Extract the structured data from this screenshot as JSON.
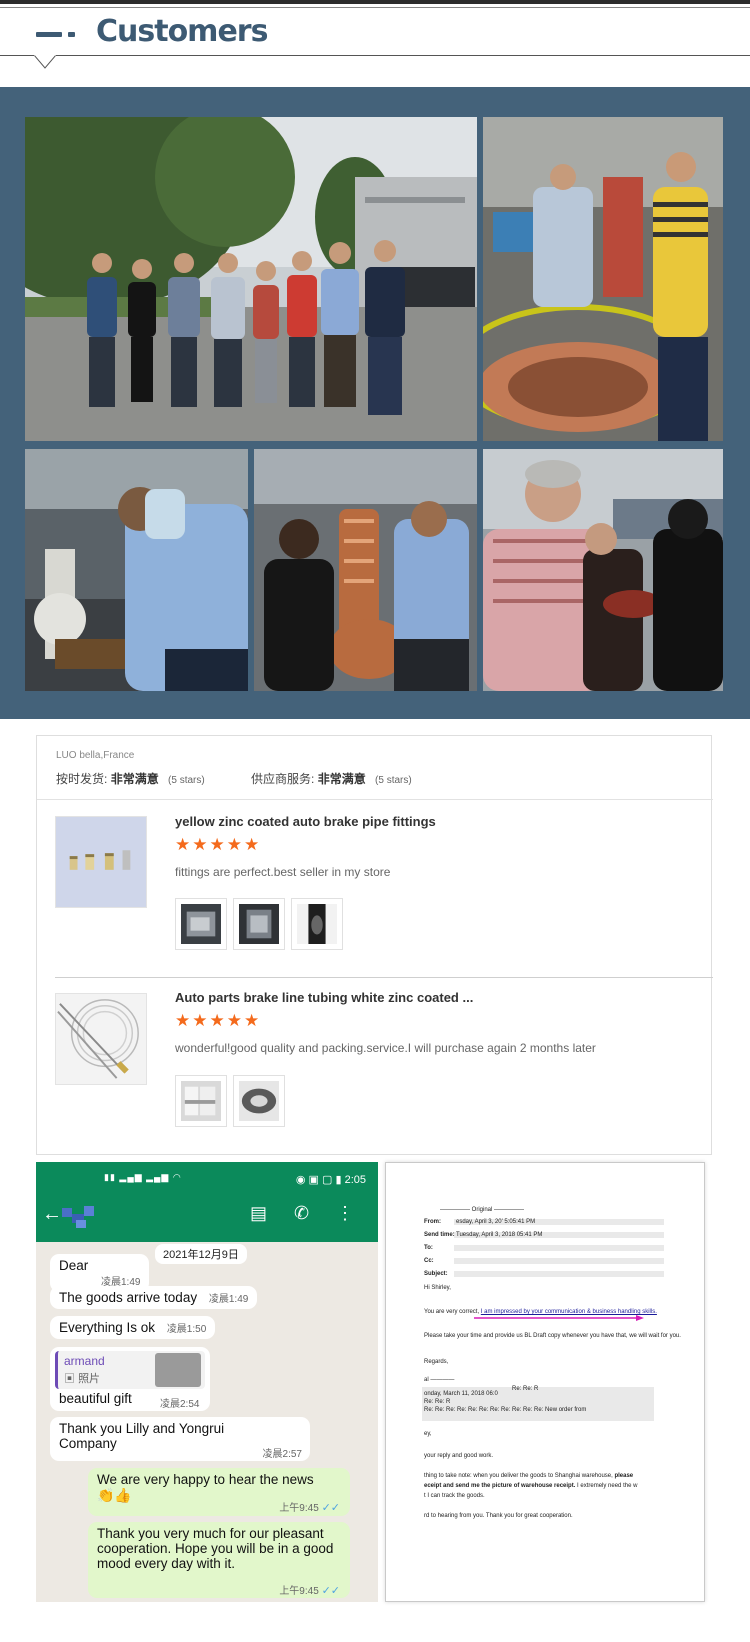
{
  "header": {
    "title": "Customers"
  },
  "review": {
    "user": "LUO bella,France",
    "ratings": [
      {
        "label": "按时发货:",
        "value": "非常满意",
        "stars": "(5 stars)"
      },
      {
        "label": "供应商服务:",
        "value": "非常满意",
        "stars": "(5 stars)"
      }
    ],
    "items": [
      {
        "title": "yellow zinc coated auto brake pipe fittings",
        "stars": "★★★★★",
        "comment": "fittings are perfect.best seller in my store"
      },
      {
        "title": "Auto parts brake line tubing white zinc coated ...",
        "stars": "★★★★★",
        "comment": "wonderful!good quality and packing.service.I will purchase again 2 months later"
      }
    ]
  },
  "chat": {
    "status_right": "2:05",
    "date": "2021年12月9日",
    "messages": [
      {
        "text": "Dear",
        "time": "凌晨1:49"
      },
      {
        "text": "The goods arrive today",
        "time": "凌晨1:49"
      },
      {
        "text": "Everything Is ok",
        "time": "凌晨1:50"
      },
      {
        "quote_name": "armand",
        "quote_type": "照片",
        "text": "beautiful gift",
        "time": "凌晨2:54"
      },
      {
        "text": "Thank you Lilly and Yongrui Company",
        "time": "凌晨2:57"
      },
      {
        "text": "We are very happy to hear the news",
        "emoji": "👏👍",
        "time": "上午9:45",
        "mine": true
      },
      {
        "text": "Thank you very much for our pleasant cooperation. Hope you will be in a good mood every day with it.",
        "time": "上午9:45",
        "mine": true
      }
    ]
  },
  "email": {
    "original": "Original",
    "from_label": "From:",
    "from_value": "esday, April 3, 20' 5:05:41 PM",
    "sent_label": "Send time:",
    "sent_value": "Tuesday, April 3, 2018 05:41 PM",
    "to_label": "To:",
    "cc_label": "Cc:",
    "subject_label": "Subject:",
    "greeting": "Hi Shirley,",
    "line1a": "You are very correct, ",
    "line1b": "I am impressed by your communication & business handling skills.",
    "line2": "Please take your time and provide us BL Draft copy whenever you have that, we will wait for you.",
    "regards": "Regards,",
    "quote_date": "onday, March 11, 2018 06:0",
    "quote_re": "Re: Re: R",
    "quote_subject": "Re: Re: Re: Re: Re: Re: Re: Re: Re: Re: Re: New order from",
    "hey": "ey,",
    "reply": "your reply and good work.",
    "note_a": "thing to take note: when you deliver the goods to Shanghai warehouse, ",
    "note_b": "please",
    "note_c": "eceipt and send me the picture of warehouse receipt.",
    "note_d": " I extremely need the w",
    "note_e": "t I can track the goods.",
    "closing": "rd to hearing from you. Thank you for great cooperation."
  }
}
